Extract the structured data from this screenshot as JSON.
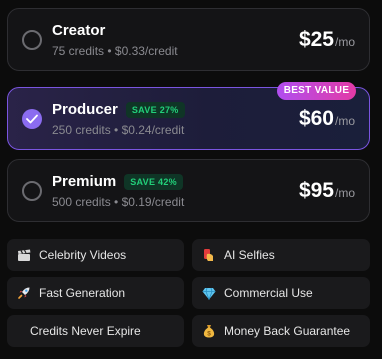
{
  "plans": [
    {
      "name": "Creator",
      "details": "75 credits • $0.33/credit",
      "save": "",
      "price": "$25",
      "unit": "/mo",
      "selected": false
    },
    {
      "name": "Producer",
      "details": "250 credits • $0.24/credit",
      "save": "SAVE 27%",
      "price": "$60",
      "unit": "/mo",
      "selected": true,
      "badge": "BEST VALUE"
    },
    {
      "name": "Premium",
      "details": "500 credits • $0.19/credit",
      "save": "SAVE 42%",
      "price": "$95",
      "unit": "/mo",
      "selected": false
    }
  ],
  "features": [
    {
      "label": "Celebrity Videos",
      "icon": "clapper-board-icon"
    },
    {
      "label": "AI Selfies",
      "icon": "selfie-hand-icon"
    },
    {
      "label": "Fast Generation",
      "icon": "rocket-icon"
    },
    {
      "label": "Commercial Use",
      "icon": "diamond-icon"
    },
    {
      "label": "Credits Never Expire",
      "icon": ""
    },
    {
      "label": "Money Back Guarantee",
      "icon": "money-bag-icon"
    }
  ],
  "colors": {
    "accent": "#8b6cf0",
    "save_green": "#22d07a",
    "badge_start": "#b04ef0",
    "badge_end": "#e33aa6"
  }
}
